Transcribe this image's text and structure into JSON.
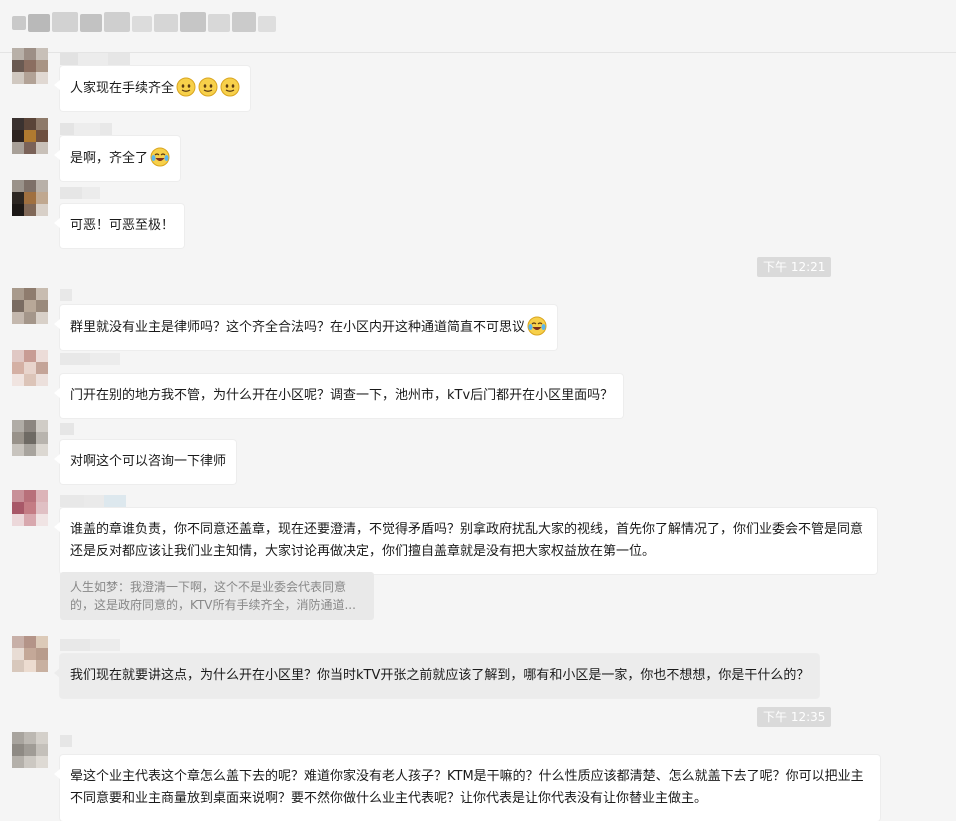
{
  "chat": {
    "messages": [
      {
        "text": "人家现在手续齐全",
        "emojis": [
          "slight-smile-icon",
          "slight-smile-icon",
          "slight-smile-icon"
        ]
      },
      {
        "text": "是啊，齐全了",
        "emojis": [
          "tears-of-joy-icon"
        ]
      },
      {
        "text": "可恶！可恶至极！"
      },
      {
        "text": "群里就没有业主是律师吗？这个齐全合法吗？在小区内开这种通道简直不可思议",
        "emojis": [
          "tears-of-joy-icon"
        ]
      },
      {
        "text": "门开在别的地方我不管，为什么开在小区呢？调查一下，池州市，kTv后门都开在小区里面吗？"
      },
      {
        "text": "对啊这个可以咨询一下律师"
      },
      {
        "text": "谁盖的章谁负责，你不同意还盖章，现在还要澄清，不觉得矛盾吗？别拿政府扰乱大家的视线，首先你了解情况了，你们业委会不管是同意还是反对都应该让我们业主知情，大家讨论再做决定，你们擅自盖章就是没有把大家权益放在第一位。",
        "quote": "人生如梦：我澄清一下啊，这个不是业委会代表同意的，这是政府同意的，KTV所有手续齐全，消防通道..."
      },
      {
        "text": "我们现在就要讲这点，为什么开在小区里？你当时kTV开张之前就应该了解到，哪有和小区是一家，你也不想想，你是干什么的？"
      },
      {
        "text": "晕这个业主代表这个章怎么盖下去的呢？难道你家没有老人孩子？KTM是干嘛的？什么性质应该都清楚、怎么就盖下去了呢？你可以把业主不同意要和业主商量放到桌面来说啊？要不然你做什么业主代表呢？让你代表是让你代表没有让你替业主做主。"
      }
    ],
    "timestamps": [
      "下午 12:21",
      "下午 12:35"
    ]
  },
  "colors": {
    "background": "#f5f5f5",
    "bubble": "#ffffff",
    "bubble_highlight": "#ececec",
    "timestamp_bg": "#dadada"
  }
}
